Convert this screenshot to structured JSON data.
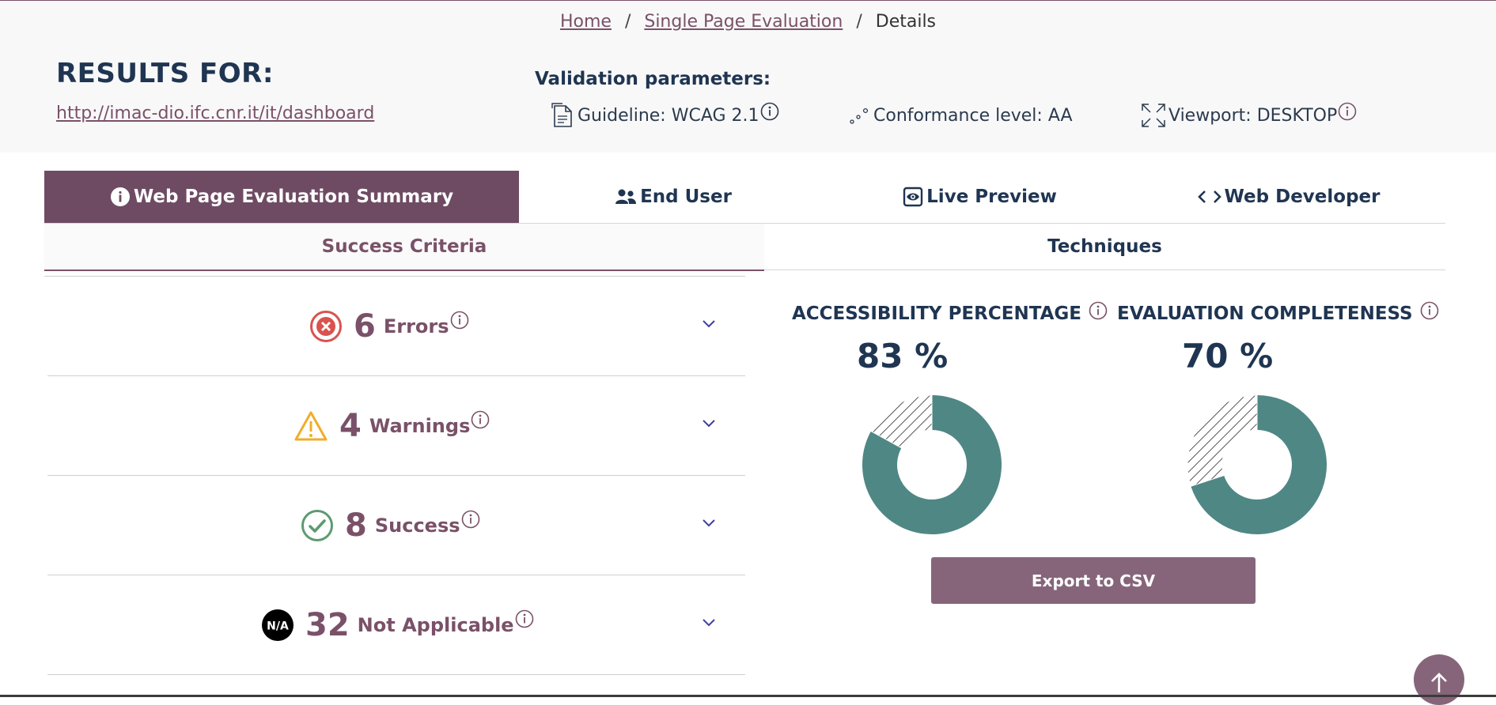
{
  "breadcrumb": {
    "home": "Home",
    "single_page": "Single Page Evaluation",
    "current": "Details",
    "separator": "/"
  },
  "results": {
    "title": "RESULTS FOR:",
    "url": "http://imac-dio.ifc.cnr.it/it/dashboard"
  },
  "validation": {
    "title": "Validation parameters:",
    "guideline": "Guideline: WCAG 2.1",
    "conformance": "Conformance level: AA",
    "viewport": "Viewport: DESKTOP"
  },
  "tabs": [
    {
      "label": "Web Page Evaluation Summary",
      "icon": "info-circle-icon",
      "active": true
    },
    {
      "label": "End User",
      "icon": "people-icon",
      "active": false
    },
    {
      "label": "Live Preview",
      "icon": "eye-icon",
      "active": false
    },
    {
      "label": "Web Developer",
      "icon": "code-icon",
      "active": false
    }
  ],
  "subtabs": {
    "success_criteria": "Success Criteria",
    "techniques": "Techniques"
  },
  "criteria": [
    {
      "count": "6",
      "label": "Errors",
      "icon": "error-x-circle-icon",
      "color": "#d9534f"
    },
    {
      "count": "4",
      "label": "Warnings",
      "icon": "warning-triangle-icon",
      "color": "#f0ad2b"
    },
    {
      "count": "8",
      "label": "Success",
      "icon": "check-circle-icon",
      "color": "#5d9b70"
    },
    {
      "count": "32",
      "label": "Not Applicable",
      "icon": "na-badge-icon",
      "color": "#000000",
      "badge_text": "N/A"
    }
  ],
  "metrics": {
    "accessibility": {
      "title": "ACCESSIBILITY PERCENTAGE",
      "value": "83 %",
      "percent": 83
    },
    "completeness": {
      "title": "EVALUATION COMPLETENESS",
      "value": "70 %",
      "percent": 70
    }
  },
  "export_label": "Export to CSV",
  "colors": {
    "brand": "#6e4b63",
    "donut_fill": "#4f8784",
    "heading": "#1f3552",
    "link": "#7a5168"
  }
}
